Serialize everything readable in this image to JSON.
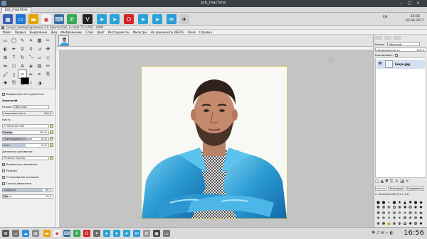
{
  "host": {
    "title": "job_machine",
    "tab_label": "job_machine"
  },
  "top_panel": {
    "tray_lang": "EN",
    "tray_time": "16:56",
    "tray_date": "03.06.2017"
  },
  "gimp": {
    "window_title": "[lunyo] (импортировано)-1.0 (Цвета RGB, 1 слой) 757x760 – GIMP",
    "menu": [
      "Файл",
      "Правка",
      "Выделение",
      "Вид",
      "Изображение",
      "Слой",
      "Цвет",
      "Инструменты",
      "Фильтры",
      "На документы (BETA)",
      "Окна",
      "Справка"
    ]
  },
  "tool_options": {
    "header": "Параметры инструментов",
    "tool_name": "Аэрограф",
    "mode_label": "Режим:",
    "mode_value": "Обычный",
    "opacity_label": "Непрозрачность",
    "opacity_value": "100,0",
    "brush_label": "Кисть",
    "brush_value": "2. Hardness 050",
    "size_label": "Размер",
    "size_value": "20,00",
    "aspect_label": "Соотношение сторон",
    "aspect_value": "0,00",
    "angle_label": "Угол",
    "angle_value": "0,00",
    "dynamics_label": "Динамика рисования",
    "dynamics_value": "Pressure Opacity",
    "dyn_params_label": "Параметры динамики",
    "jitter_label": "Разброс",
    "smooth_label": "Сглаживание штрихов",
    "incremental_label": "Только движение",
    "rate_label": "Скорость",
    "rate_value": "80,0",
    "flow_label": "Поток",
    "flow_value": "10,0"
  },
  "dock": {
    "mode_label": "Режим",
    "mode_value": "Обычный",
    "opacity_label": "Непрозрачность",
    "opacity_value": "100,0",
    "lock_label": "Блокировка:",
    "layer_name": "lunyo.jpg",
    "brush_tabs": [
      "Кисти",
      "Текстуры",
      "Градиенты"
    ],
    "brush_current": "2. Hardness 050 (51 × 51)"
  },
  "taskbar": {
    "clock": "16:56"
  },
  "colors": {
    "accent": "#4a6b9c",
    "jacket": "#2fa0d8",
    "selection": "#e0c440"
  }
}
